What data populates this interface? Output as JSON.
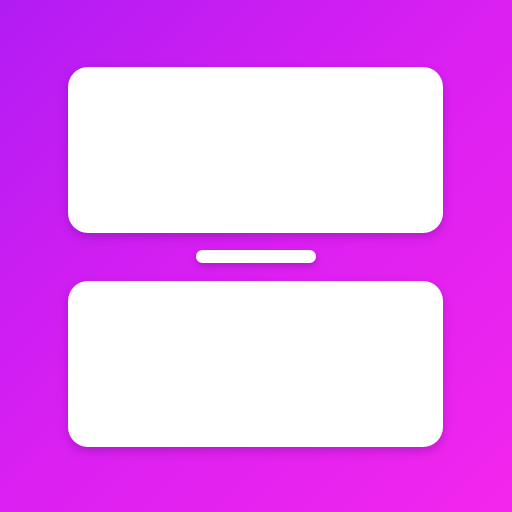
{
  "icon": {
    "name": "split-screen-icon",
    "background_gradient": [
      "#b11cf3",
      "#d81ff2",
      "#f326ed"
    ],
    "panel_color": "#ffffff",
    "divider_color": "#ffffff"
  }
}
